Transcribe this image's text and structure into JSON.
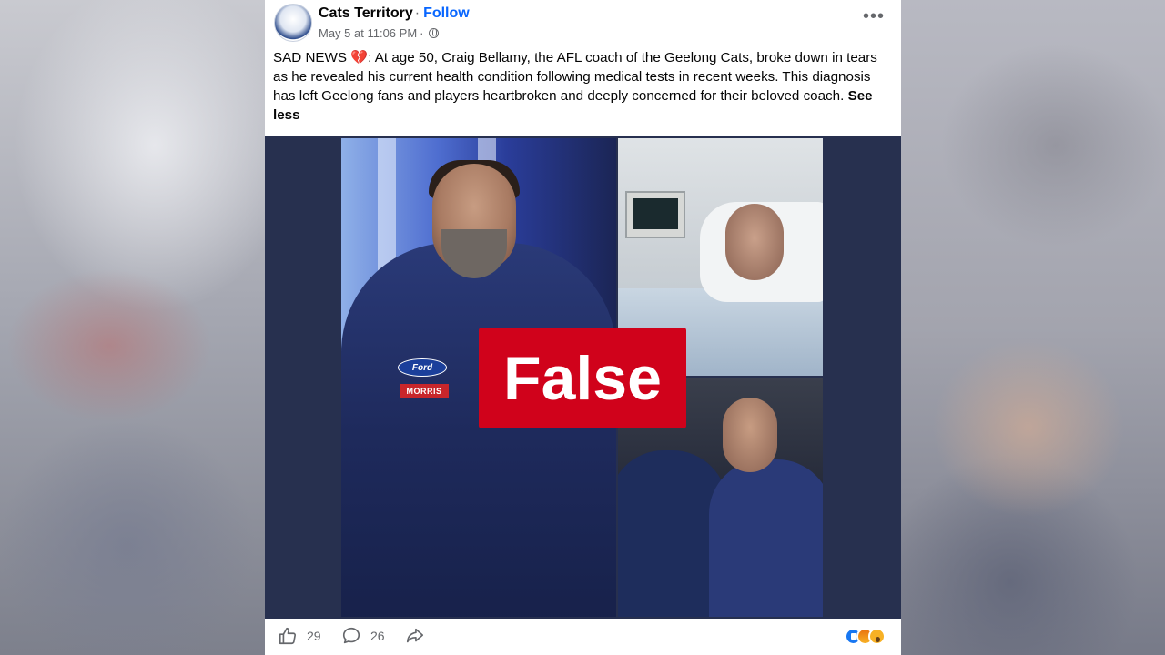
{
  "post": {
    "page_name": "Cats Territory",
    "separator": "·",
    "follow_label": "Follow",
    "timestamp": "May 5 at 11:06 PM",
    "timestamp_sep": "·",
    "more_label": "•••",
    "text_prefix": "SAD NEWS",
    "text_emoji": "💔",
    "text_body": ": At age 50, Craig Bellamy, the AFL coach of the Geelong Cats, broke down in tears as he revealed his current health condition following medical tests in recent weeks. This diagnosis has left Geelong fans and players heartbroken and deeply concerned for their beloved coach.",
    "see_less_label": "See less"
  },
  "media": {
    "overlay_label": "False",
    "jacket_brand": "Ford",
    "jacket_sponsor": "MORRIS"
  },
  "actions": {
    "like_count": "29",
    "comment_count": "26"
  },
  "colors": {
    "follow": "#0866ff",
    "false_label": "#d0021b",
    "media_bg": "#27304f"
  },
  "icons": [
    "globe-icon",
    "more-icon",
    "like-icon",
    "comment-icon",
    "share-icon",
    "reaction-like-icon",
    "reaction-angry-icon",
    "reaction-wow-icon"
  ]
}
